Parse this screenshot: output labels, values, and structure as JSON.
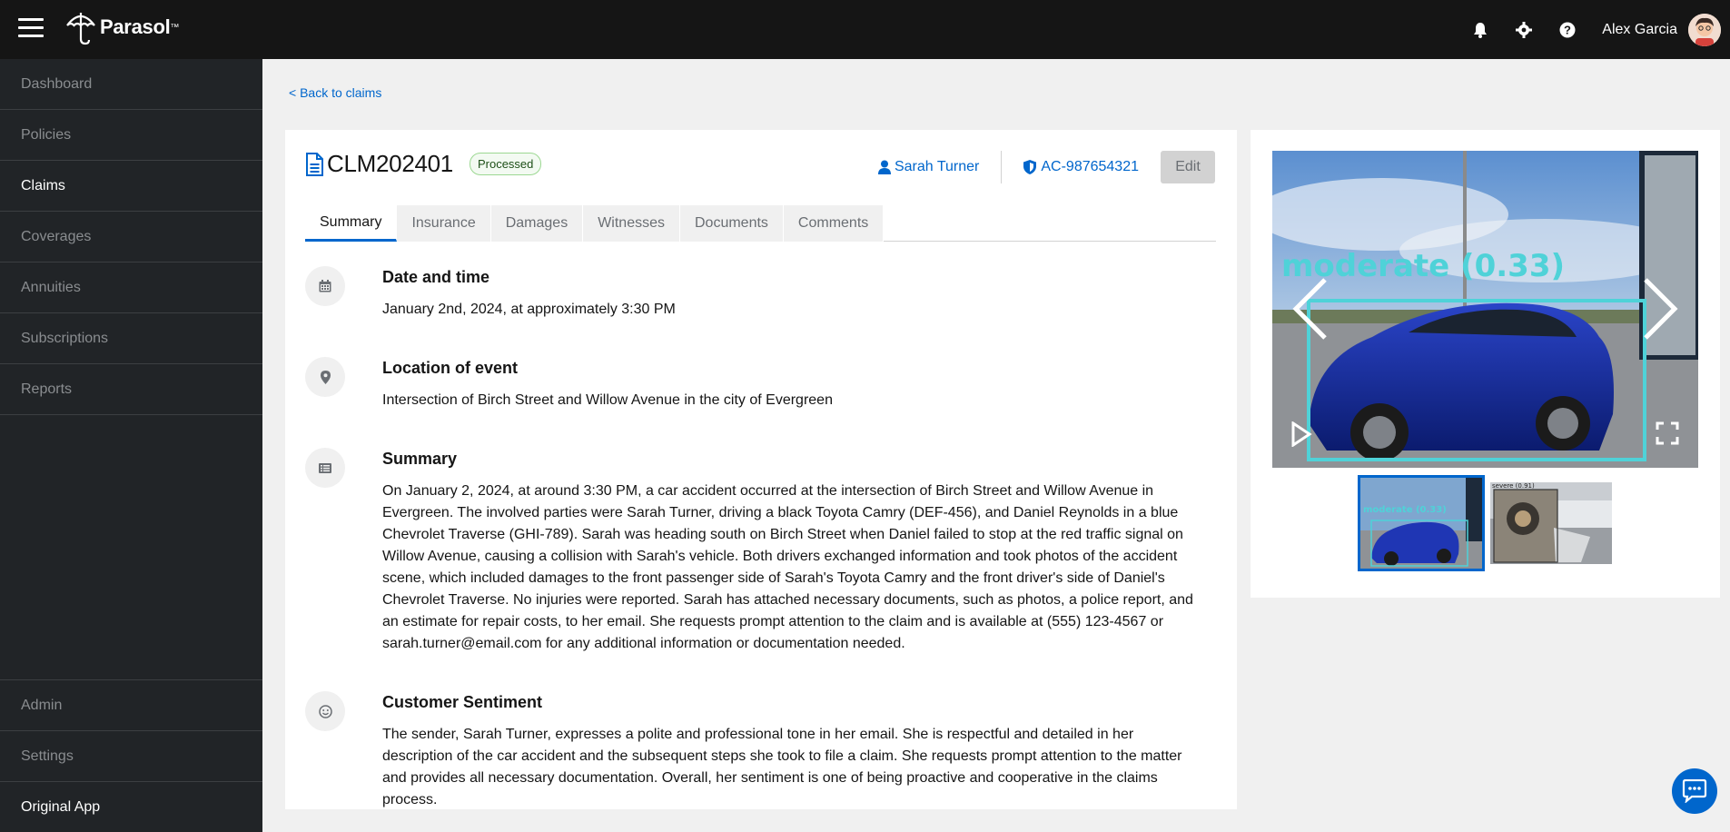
{
  "brand": {
    "name": "Parasol",
    "tm": "™"
  },
  "user": {
    "name": "Alex Garcia"
  },
  "sidebar": {
    "items": [
      {
        "label": "Dashboard"
      },
      {
        "label": "Policies"
      },
      {
        "label": "Claims"
      },
      {
        "label": "Coverages"
      },
      {
        "label": "Annuities"
      },
      {
        "label": "Subscriptions"
      },
      {
        "label": "Reports"
      }
    ],
    "bottom": [
      {
        "label": "Admin"
      },
      {
        "label": "Settings"
      },
      {
        "label": "Original App"
      }
    ]
  },
  "back_link": "< Back to claims",
  "claim": {
    "id": "CLM202401",
    "status": "Processed",
    "client": "Sarah Turner",
    "policy": "AC-987654321",
    "edit_label": "Edit"
  },
  "tabs": [
    {
      "label": "Summary"
    },
    {
      "label": "Insurance"
    },
    {
      "label": "Damages"
    },
    {
      "label": "Witnesses"
    },
    {
      "label": "Documents"
    },
    {
      "label": "Comments"
    }
  ],
  "sections": {
    "datetime": {
      "title": "Date and time",
      "body": "January 2nd, 2024, at approximately 3:30 PM"
    },
    "location": {
      "title": "Location of event",
      "body": "Intersection of Birch Street and Willow Avenue in the city of Evergreen"
    },
    "summary": {
      "title": "Summary",
      "body": "On January 2, 2024, at around 3:30 PM, a car accident occurred at the intersection of Birch Street and Willow Avenue in Evergreen. The involved parties were Sarah Turner, driving a black Toyota Camry (DEF-456), and Daniel Reynolds in a blue Chevrolet Traverse (GHI-789). Sarah was heading south on Birch Street when Daniel failed to stop at the red traffic signal on Willow Avenue, causing a collision with Sarah's vehicle. Both drivers exchanged information and took photos of the accident scene, which included damages to the front passenger side of Sarah's Toyota Camry and the front driver's side of Daniel's Chevrolet Traverse. No injuries were reported. Sarah has attached necessary documents, such as photos, a police report, and an estimate for repair costs, to her email. She requests prompt attention to the claim and is available at (555) 123-4567 or sarah.turner@email.com for any additional information or documentation needed."
    },
    "sentiment": {
      "title": "Customer Sentiment",
      "body": "The sender, Sarah Turner, expresses a polite and professional tone in her email. She is respectful and detailed in her description of the car accident and the subsequent steps she took to file a claim. She requests prompt attention to the matter and provides all necessary documentation. Overall, her sentiment is one of being proactive and cooperative in the claims process."
    }
  },
  "gallery": {
    "detection_label": "moderate (0.33)",
    "thumb1_label": "moderate (0.33)",
    "thumb2_label": "severe (0.91)"
  },
  "colors": {
    "accent": "#0066cc",
    "topbar": "#151515",
    "sidebar": "#212427",
    "badge_border": "#9cd892",
    "detection": "#4fd2d8"
  },
  "icons": [
    "hamburger-icon",
    "umbrella-logo-icon",
    "bell-icon",
    "gear-icon",
    "help-icon",
    "user-icon",
    "shield-icon",
    "document-icon",
    "calendar-icon",
    "map-pin-icon",
    "list-icon",
    "smiley-icon",
    "chevron-left-icon",
    "chevron-right-icon",
    "play-icon",
    "fullscreen-icon",
    "chat-icon"
  ]
}
